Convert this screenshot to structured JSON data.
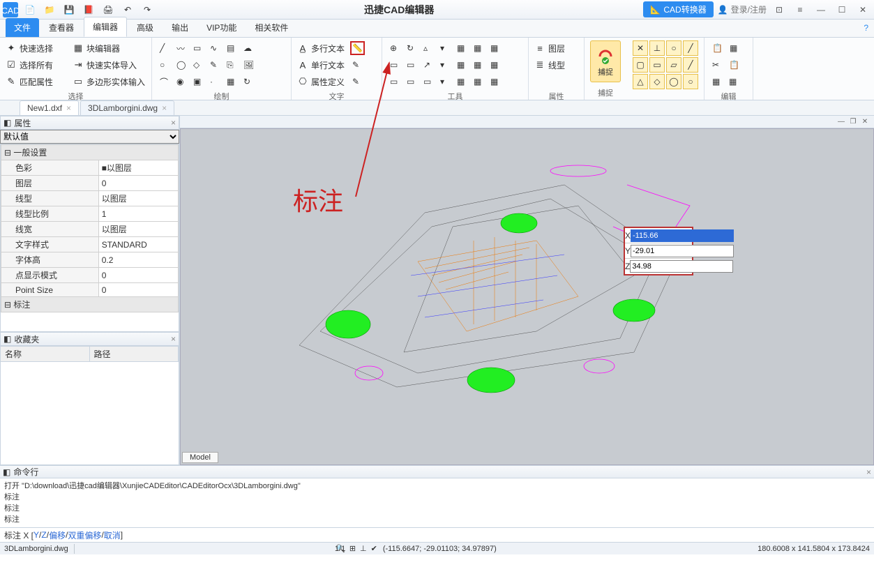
{
  "app_title": "迅捷CAD编辑器",
  "titlebar_buttons": {
    "converter": "CAD转换器",
    "login": "登录/注册"
  },
  "tabs": [
    "文件",
    "查看器",
    "编辑器",
    "高级",
    "输出",
    "VIP功能",
    "相关软件"
  ],
  "active_tab_index": 2,
  "ribbon": {
    "groups": [
      {
        "label": "选择",
        "items": [
          [
            "快速选择",
            "块编辑器"
          ],
          [
            "选择所有",
            "快速实体导入"
          ],
          [
            "匹配属性",
            "多边形实体输入"
          ]
        ]
      },
      {
        "label": "绘制"
      },
      {
        "label": "文字",
        "items": [
          [
            "多行文本"
          ],
          [
            "单行文本"
          ],
          [
            "属性定义"
          ]
        ]
      },
      {
        "label": "工具"
      },
      {
        "label": "属性",
        "items": [
          [
            "图层"
          ],
          [
            "线型"
          ]
        ]
      },
      {
        "label": "捕捉",
        "big": "捕捉"
      },
      {
        "label": "编辑"
      }
    ]
  },
  "doctabs": [
    "New1.dxf",
    "3DLamborgini.dwg"
  ],
  "active_doctab": 1,
  "panels": {
    "properties_title": "属性",
    "default_value": "默认值",
    "section1": "一般设置",
    "rows": [
      [
        "色彩",
        "■以图层"
      ],
      [
        "图层",
        "0"
      ],
      [
        "线型",
        "以图层"
      ],
      [
        "线型比例",
        "1"
      ],
      [
        "线宽",
        "以图层"
      ],
      [
        "文字样式",
        "STANDARD"
      ],
      [
        "字体高",
        "0.2"
      ],
      [
        "点显示模式",
        "0"
      ],
      [
        "Point Size",
        "0"
      ]
    ],
    "section2": "标注",
    "favorites_title": "收藏夹",
    "fav_headers": [
      "名称",
      "路径"
    ]
  },
  "annotation_label": "标注",
  "coord": {
    "x_label": "X",
    "y_label": "Y",
    "z_label": "Z",
    "x": "-115.66",
    "y": "-29.01",
    "z": "34.98"
  },
  "model_tab": "Model",
  "cmd": {
    "title": "命令行",
    "lines": [
      "打开 \"D:\\download\\迅捷cad编辑器\\XunjieCADEditor\\CADEditorOcx\\3DLamborgini.dwg\"",
      "标注",
      "标注",
      "标注"
    ],
    "prompt_prefix": "标注  X [ ",
    "prompt_links": [
      "Y",
      " / ",
      "Z",
      " / ",
      "偏移",
      " / ",
      "双重偏移",
      " / ",
      "取消"
    ],
    "prompt_suffix": " ]  "
  },
  "status": {
    "file": "3DLamborgini.dwg",
    "pages": "1/1",
    "coords": "(-115.6647; -29.01103; 34.97897)",
    "bounds": "180.6008 x 141.5804 x 173.8424"
  }
}
